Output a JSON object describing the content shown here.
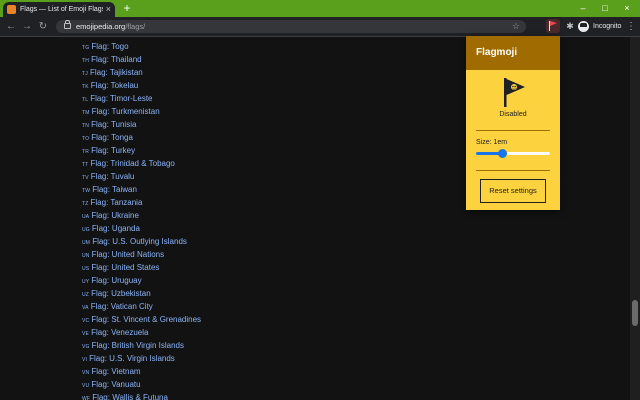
{
  "browser": {
    "tab": {
      "title": "Flags — List of Emoji Flags in",
      "close": "×"
    },
    "new_tab": "+",
    "window_controls": {
      "minimize": "–",
      "maximize": "□",
      "close": "×"
    },
    "url_domain": "emojipedia.org",
    "url_path": "/flags/",
    "profile_label": "Incognito"
  },
  "flags": [
    {
      "code": "TG",
      "label": "Flag: Togo"
    },
    {
      "code": "TH",
      "label": "Flag: Thailand"
    },
    {
      "code": "TJ",
      "label": "Flag: Tajikistan"
    },
    {
      "code": "TK",
      "label": "Flag: Tokelau"
    },
    {
      "code": "TL",
      "label": "Flag: Timor-Leste"
    },
    {
      "code": "TM",
      "label": "Flag: Turkmenistan"
    },
    {
      "code": "TN",
      "label": "Flag: Tunisia"
    },
    {
      "code": "TO",
      "label": "Flag: Tonga"
    },
    {
      "code": "TR",
      "label": "Flag: Turkey"
    },
    {
      "code": "TT",
      "label": "Flag: Trinidad & Tobago"
    },
    {
      "code": "TV",
      "label": "Flag: Tuvalu"
    },
    {
      "code": "TW",
      "label": "Flag: Taiwan"
    },
    {
      "code": "TZ",
      "label": "Flag: Tanzania"
    },
    {
      "code": "UA",
      "label": "Flag: Ukraine"
    },
    {
      "code": "UG",
      "label": "Flag: Uganda"
    },
    {
      "code": "UM",
      "label": "Flag: U.S. Outlying Islands"
    },
    {
      "code": "UN",
      "label": "Flag: United Nations"
    },
    {
      "code": "US",
      "label": "Flag: United States"
    },
    {
      "code": "UY",
      "label": "Flag: Uruguay"
    },
    {
      "code": "UZ",
      "label": "Flag: Uzbekistan"
    },
    {
      "code": "VA",
      "label": "Flag: Vatican City"
    },
    {
      "code": "VC",
      "label": "Flag: St. Vincent & Grenadines"
    },
    {
      "code": "VE",
      "label": "Flag: Venezuela"
    },
    {
      "code": "VG",
      "label": "Flag: British Virgin Islands"
    },
    {
      "code": "VI",
      "label": "Flag: U.S. Virgin Islands"
    },
    {
      "code": "VN",
      "label": "Flag: Vietnam"
    },
    {
      "code": "VU",
      "label": "Flag: Vanuatu"
    },
    {
      "code": "WF",
      "label": "Flag: Wallis & Futuna"
    }
  ],
  "popup": {
    "title": "Flagmoji",
    "status": "Disabled",
    "size_label": "Size: 1em",
    "size_slider_fraction": 0.35,
    "reset_label": "Reset settings"
  },
  "colors": {
    "tab_strip": "#5aa01d",
    "popup_bg": "#fcd23e",
    "popup_header": "#a06b00",
    "link": "#8ab4f8",
    "page_bg": "#121212"
  },
  "icons": {
    "back": "back-arrow-icon",
    "forward": "forward-arrow-icon",
    "reload": "reload-icon",
    "lock": "lock-icon",
    "star": "star-icon",
    "extension_flag": "flag-icon",
    "extensions": "puzzle-icon",
    "profile": "incognito-icon",
    "menu": "kebab-menu-icon"
  }
}
